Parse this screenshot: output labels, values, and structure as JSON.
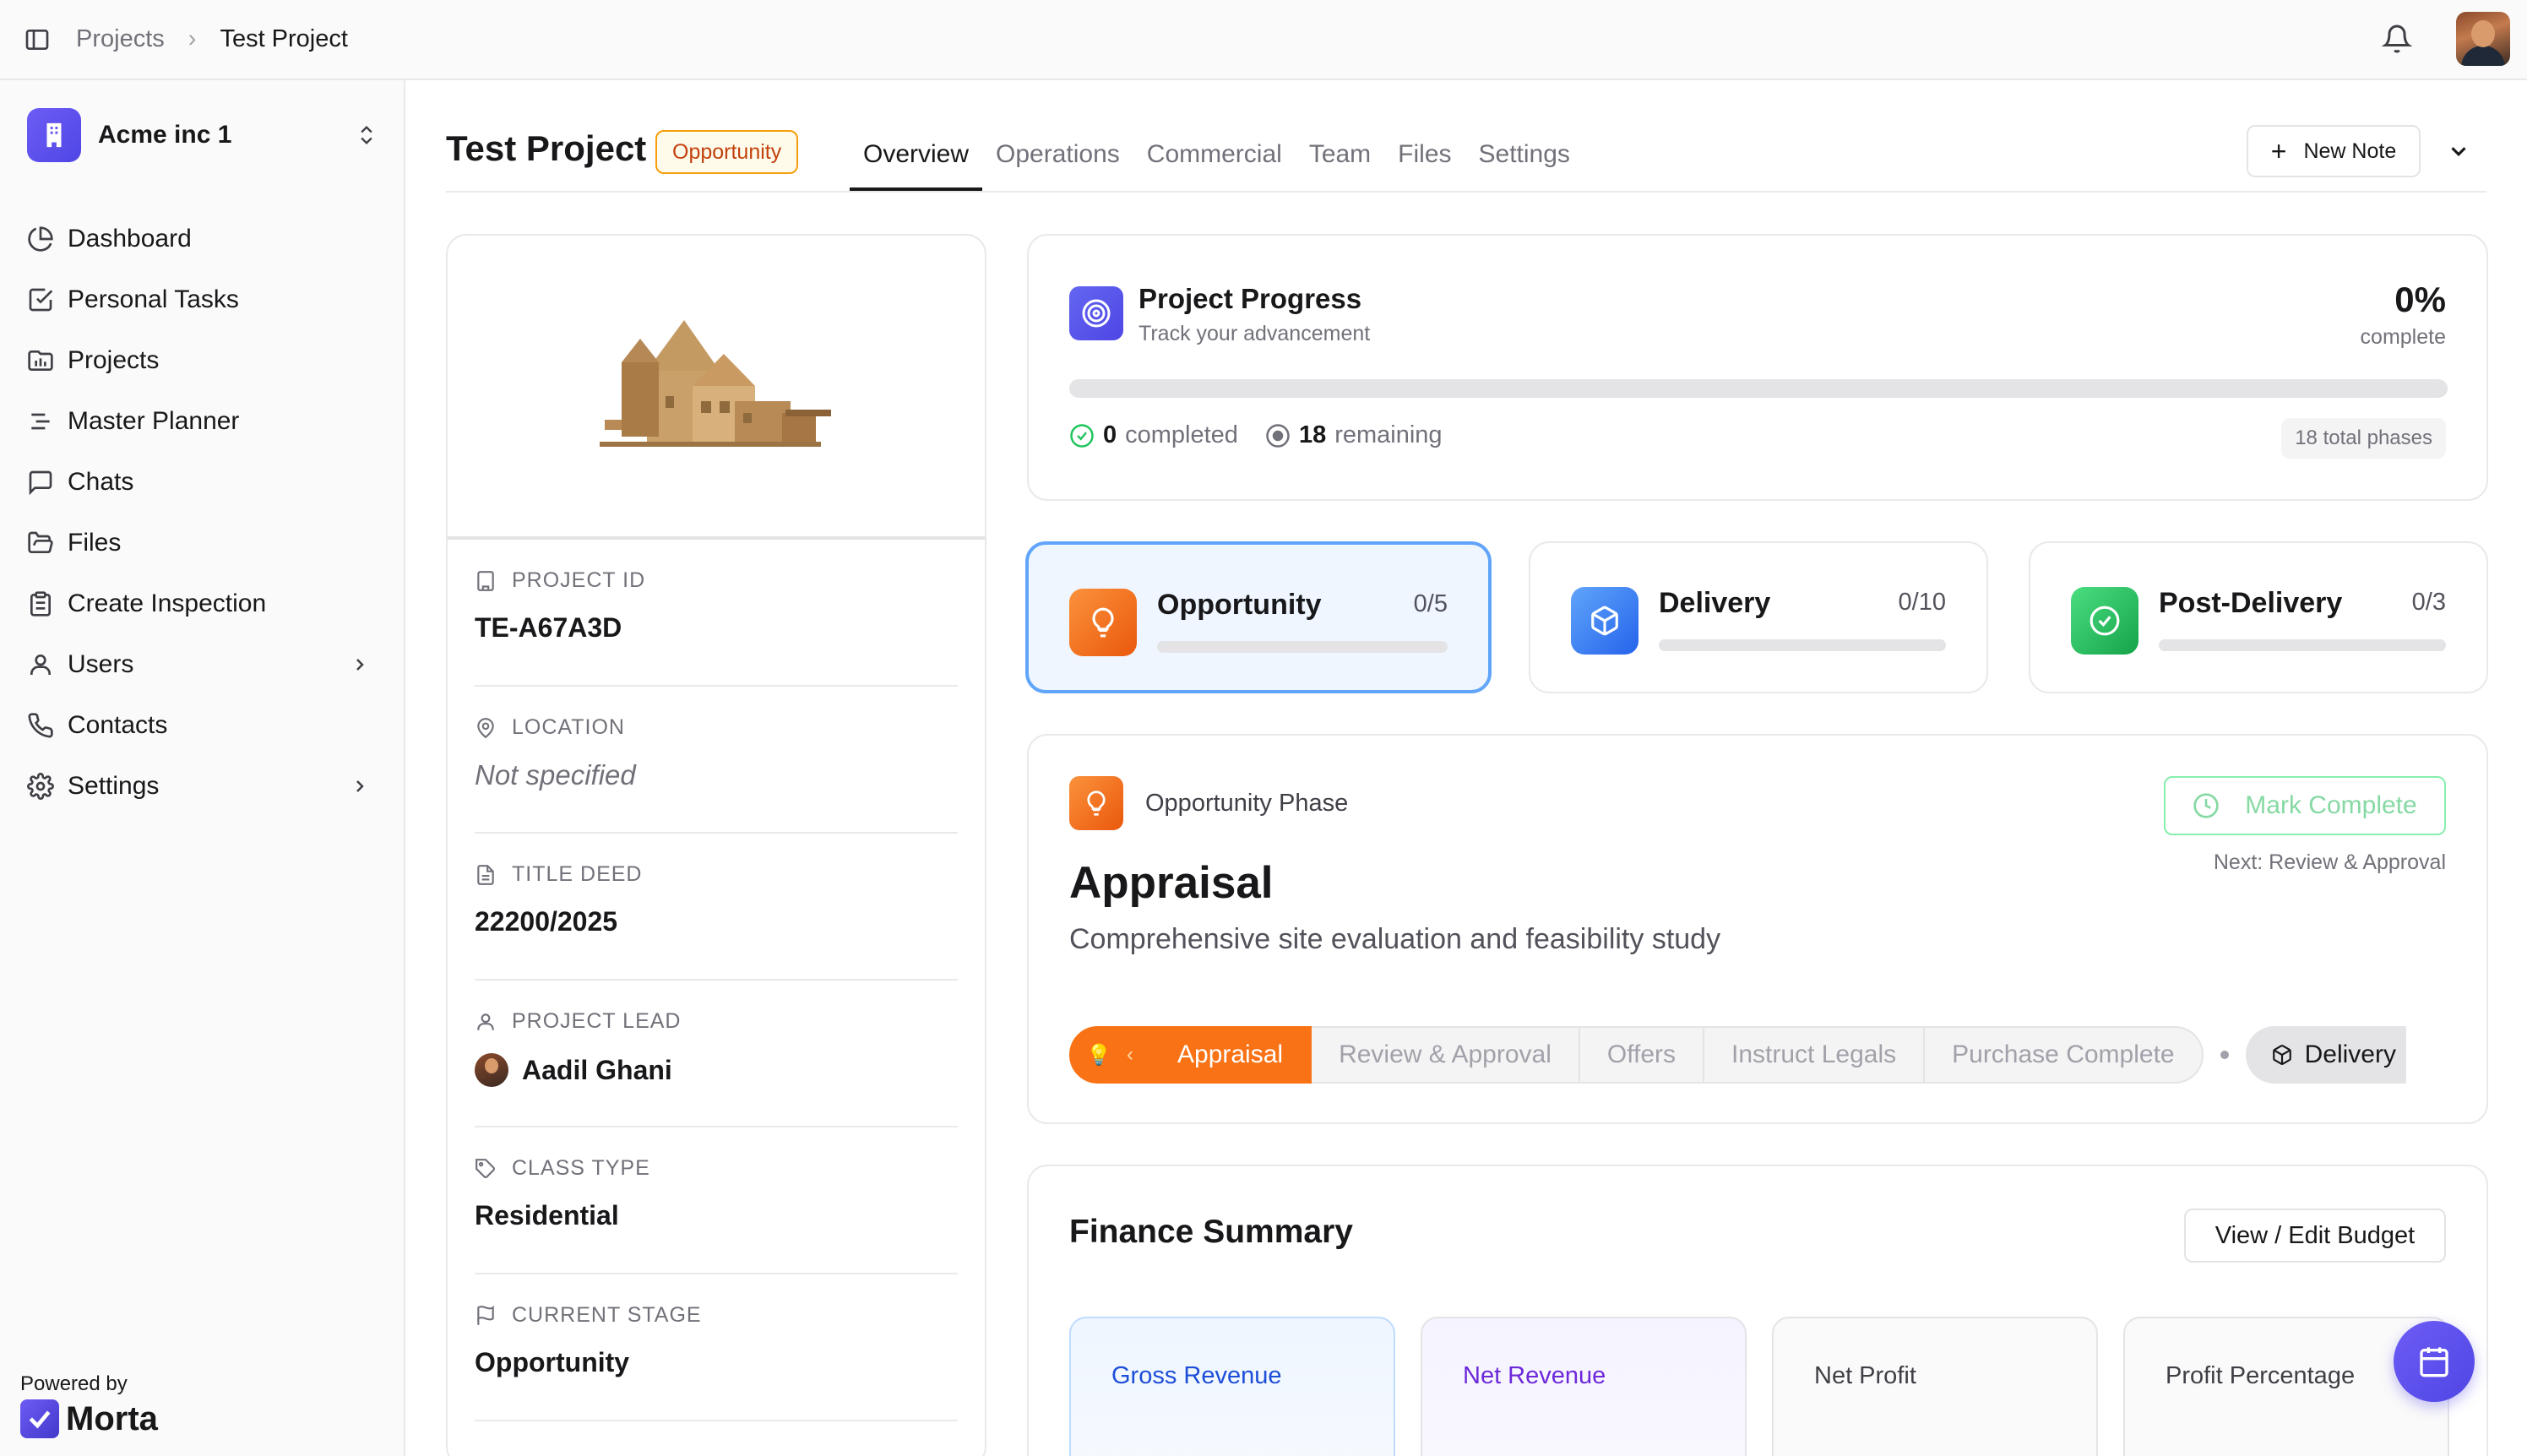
{
  "topbar": {
    "breadcrumb": [
      "Projects",
      "Test Project"
    ]
  },
  "sidebar": {
    "org_name": "Acme inc 1",
    "items": [
      {
        "label": "Dashboard",
        "icon": "pie-chart-icon"
      },
      {
        "label": "Personal Tasks",
        "icon": "checkbox-icon"
      },
      {
        "label": "Projects",
        "icon": "folder-chart-icon"
      },
      {
        "label": "Master Planner",
        "icon": "list-icon"
      },
      {
        "label": "Chats",
        "icon": "chat-icon"
      },
      {
        "label": "Files",
        "icon": "folder-open-icon"
      },
      {
        "label": "Create Inspection",
        "icon": "clipboard-icon"
      },
      {
        "label": "Users",
        "icon": "user-icon"
      },
      {
        "label": "Contacts",
        "icon": "phone-icon"
      },
      {
        "label": "Settings",
        "icon": "gear-icon"
      }
    ],
    "powered_by": "Powered by",
    "brand": "Morta"
  },
  "header": {
    "title": "Test Project",
    "badge": "Opportunity",
    "tabs": [
      "Overview",
      "Operations",
      "Commercial",
      "Team",
      "Files",
      "Settings"
    ],
    "active_tab": "Overview",
    "new_note": "New Note"
  },
  "info": {
    "fields": [
      {
        "label": "PROJECT ID",
        "value": "TE-A67A3D",
        "icon": "building-icon"
      },
      {
        "label": "LOCATION",
        "value": "Not specified",
        "icon": "map-pin-icon"
      },
      {
        "label": "TITLE DEED",
        "value": "22200/2025",
        "icon": "document-icon"
      },
      {
        "label": "PROJECT LEAD",
        "value": "Aadil Ghani",
        "icon": "user-icon"
      },
      {
        "label": "CLASS TYPE",
        "value": "Residential",
        "icon": "tag-icon"
      },
      {
        "label": "CURRENT STAGE",
        "value": "Opportunity",
        "icon": "flag-icon"
      }
    ]
  },
  "progress": {
    "title": "Project Progress",
    "subtitle": "Track your advancement",
    "percent": "0%",
    "percent_value": 0,
    "complete_label": "complete",
    "completed_count": "0",
    "completed_label": "completed",
    "remaining_count": "18",
    "remaining_label": "remaining",
    "total_phases": "18 total phases"
  },
  "phases": [
    {
      "name": "Opportunity",
      "count": "0/5",
      "fraction": 0,
      "color": "#f97316"
    },
    {
      "name": "Delivery",
      "count": "0/10",
      "fraction": 0,
      "color": "#3b82f6"
    },
    {
      "name": "Post-Delivery",
      "count": "0/3",
      "fraction": 0,
      "color": "#22c55e"
    }
  ],
  "detail": {
    "phase_label": "Opportunity Phase",
    "mark_complete": "Mark Complete",
    "next": "Next: Review & Approval",
    "title": "Appraisal",
    "description": "Comprehensive site evaluation and feasibility study",
    "steps": [
      "Appraisal",
      "Review & Approval",
      "Offers",
      "Instruct Legals",
      "Purchase Complete"
    ],
    "active_step": "Appraisal",
    "next_phase": "Delivery"
  },
  "finance": {
    "title": "Finance Summary",
    "button": "View / Edit Budget",
    "tiles": [
      {
        "label": "Gross Revenue",
        "color": "#1d4ed8"
      },
      {
        "label": "Net Revenue",
        "color": "#6d28d9"
      },
      {
        "label": "Net Profit",
        "color": "#3f3f46"
      },
      {
        "label": "Profit Percentage",
        "color": "#3f3f46"
      }
    ]
  },
  "colors": {
    "accent": "#4f46e5",
    "opportunity": "#f97316",
    "delivery": "#3b82f6",
    "post_delivery": "#22c55e"
  }
}
